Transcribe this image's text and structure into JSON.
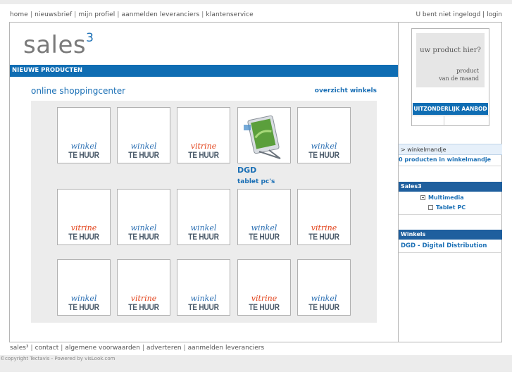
{
  "topnav": {
    "items": [
      "home",
      "nieuwsbrief",
      "mijn profiel",
      "aanmelden leveranciers",
      "klantenservice"
    ],
    "separator": "|"
  },
  "login": {
    "status": "U bent niet ingelogd",
    "separator": "|",
    "login_label": "login"
  },
  "logo": {
    "text": "sales",
    "sup": "3"
  },
  "bar": {
    "label": "NIEUWE PRODUCTEN"
  },
  "section": {
    "title": "online shoppingcenter",
    "overview_link": "overzicht winkels"
  },
  "tiles": [
    {
      "kind": "winkel",
      "line1": "winkel",
      "line2": "TE HUUR"
    },
    {
      "kind": "winkel",
      "line1": "winkel",
      "line2": "TE HUUR"
    },
    {
      "kind": "vitrine",
      "line1": "vitrine",
      "line2": "TE HUUR"
    },
    {
      "kind": "product",
      "line1": "",
      "line2": ""
    },
    {
      "kind": "winkel",
      "line1": "winkel",
      "line2": "TE HUUR"
    },
    {
      "kind": "vitrine",
      "line1": "vitrine",
      "line2": "TE HUUR"
    },
    {
      "kind": "winkel",
      "line1": "winkel",
      "line2": "TE HUUR"
    },
    {
      "kind": "winkel",
      "line1": "winkel",
      "line2": "TE HUUR"
    },
    {
      "kind": "winkel",
      "line1": "winkel",
      "line2": "TE HUUR"
    },
    {
      "kind": "vitrine",
      "line1": "vitrine",
      "line2": "TE HUUR"
    },
    {
      "kind": "winkel",
      "line1": "winkel",
      "line2": "TE HUUR"
    },
    {
      "kind": "vitrine",
      "line1": "vitrine",
      "line2": "TE HUUR"
    },
    {
      "kind": "winkel",
      "line1": "winkel",
      "line2": "TE HUUR"
    },
    {
      "kind": "vitrine",
      "line1": "vitrine",
      "line2": "TE HUUR"
    },
    {
      "kind": "winkel",
      "line1": "winkel",
      "line2": "TE HUUR"
    }
  ],
  "product": {
    "name": "DGD",
    "category": "tablet pc's"
  },
  "ad": {
    "line1": "uw product hier?",
    "line2": "product",
    "line3": "van de maand",
    "button": "UITZONDERLIJK AANBOD"
  },
  "cart": {
    "head": "> winkelmandje",
    "count": "0 producten in winkelmandje"
  },
  "sales3_block": {
    "title": "Sales3",
    "items": [
      "Multimedia",
      "Tablet PC"
    ]
  },
  "winkels_block": {
    "title": "Winkels",
    "shop": "DGD - Digital Distribution"
  },
  "footnav": {
    "items": [
      "sales³",
      "contact",
      "algemene voorwaarden",
      "adverteren",
      "aanmelden leveranciers"
    ],
    "separator": "|"
  },
  "copyright": "©copyright Tectavis - Powered by visLook.com",
  "colors": {
    "accent_blue": "#0f6db3",
    "dark_blue": "#1f5f9e",
    "winkel_blue": "#2b6fb3",
    "vitrine_red": "#e2421a"
  }
}
